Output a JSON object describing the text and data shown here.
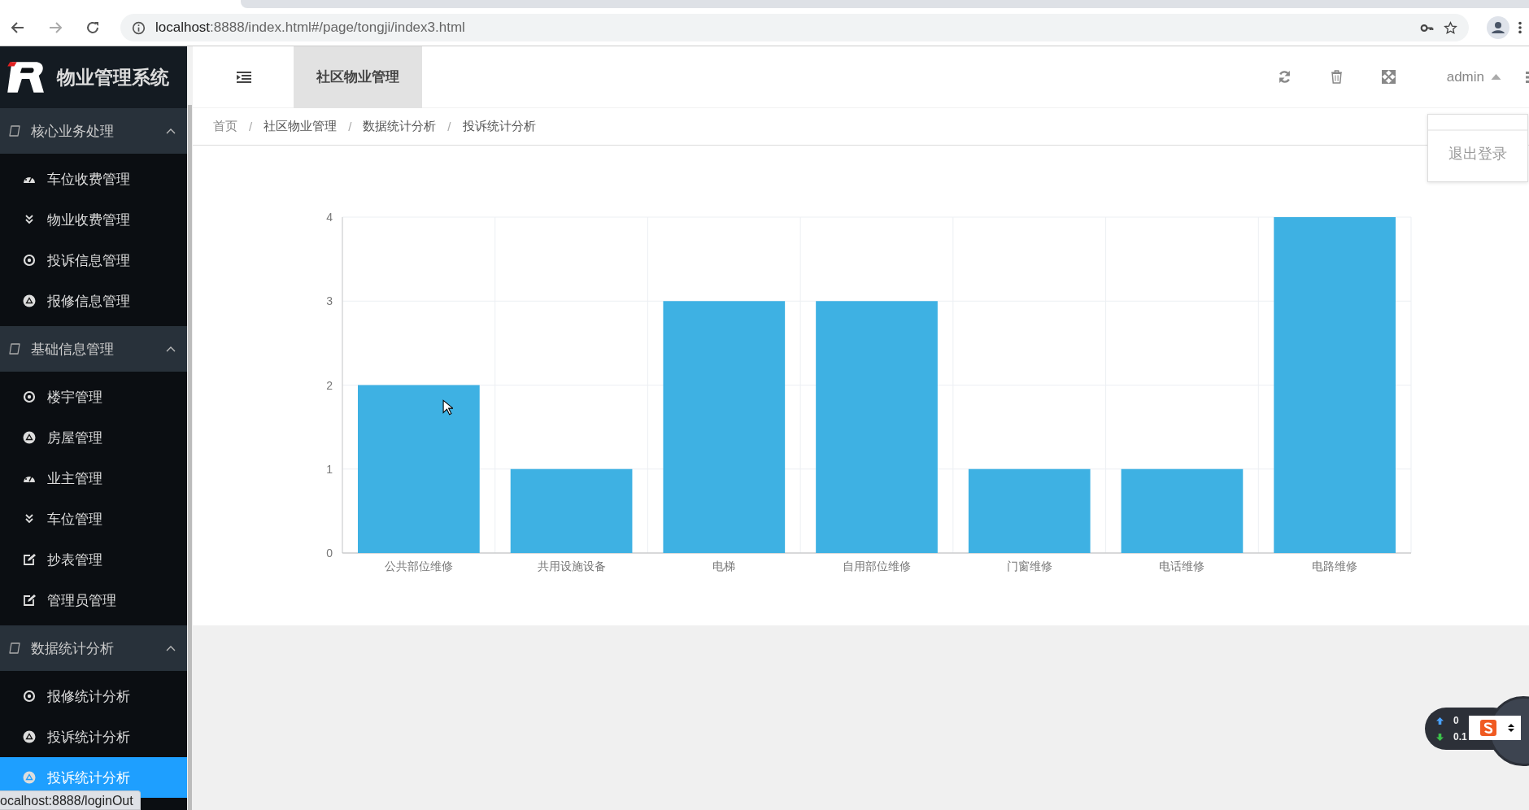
{
  "browser": {
    "url_host": "localhost",
    "url_rest": ":8888/index.html#/page/tongji/index3.html"
  },
  "app": {
    "title": "物业管理系统"
  },
  "sidebar": {
    "groups": [
      {
        "label": "核心业务处理",
        "expanded": true,
        "items": [
          {
            "label": "车位收费管理",
            "kind": "gauge",
            "selected": false
          },
          {
            "label": "物业收费管理",
            "kind": "chevrons",
            "selected": false
          },
          {
            "label": "投诉信息管理",
            "kind": "target",
            "selected": false
          },
          {
            "label": "报修信息管理",
            "kind": "triangle",
            "selected": false
          }
        ]
      },
      {
        "label": "基础信息管理",
        "expanded": true,
        "items": [
          {
            "label": "楼宇管理",
            "kind": "target",
            "selected": false
          },
          {
            "label": "房屋管理",
            "kind": "triangle",
            "selected": false
          },
          {
            "label": "业主管理",
            "kind": "gauge",
            "selected": false
          },
          {
            "label": "车位管理",
            "kind": "chevrons",
            "selected": false
          },
          {
            "label": "抄表管理",
            "kind": "edit",
            "selected": false
          },
          {
            "label": "管理员管理",
            "kind": "edit",
            "selected": false
          }
        ]
      },
      {
        "label": "数据统计分析",
        "expanded": true,
        "items": [
          {
            "label": "报修统计分析",
            "kind": "target",
            "selected": false
          },
          {
            "label": "投诉统计分析",
            "kind": "triangle",
            "selected": false
          },
          {
            "label": "投诉统计分析",
            "kind": "triangle",
            "selected": true
          }
        ]
      }
    ]
  },
  "header": {
    "tabs": [
      {
        "label": "社区物业管理",
        "selected": true
      }
    ],
    "user": "admin"
  },
  "user_menu": {
    "items": [
      "退出登录"
    ]
  },
  "breadcrumb_separator": "/",
  "breadcrumb": [
    "首页",
    "社区物业管理",
    "数据统计分析",
    "投诉统计分析"
  ],
  "chart_data": {
    "type": "bar",
    "categories": [
      "公共部位维修",
      "共用设施设备",
      "电梯",
      "自用部位维修",
      "门窗维修",
      "电话维修",
      "电路维修"
    ],
    "values": [
      2,
      1,
      3,
      3,
      1,
      1,
      4
    ],
    "ylim": [
      0,
      4
    ],
    "grid": true,
    "yticks": [
      0,
      1,
      2,
      3,
      4
    ]
  },
  "status_link": "ocalhost:8888/loginOut",
  "speed_widget": {
    "up": "0",
    "down": "0.1"
  }
}
